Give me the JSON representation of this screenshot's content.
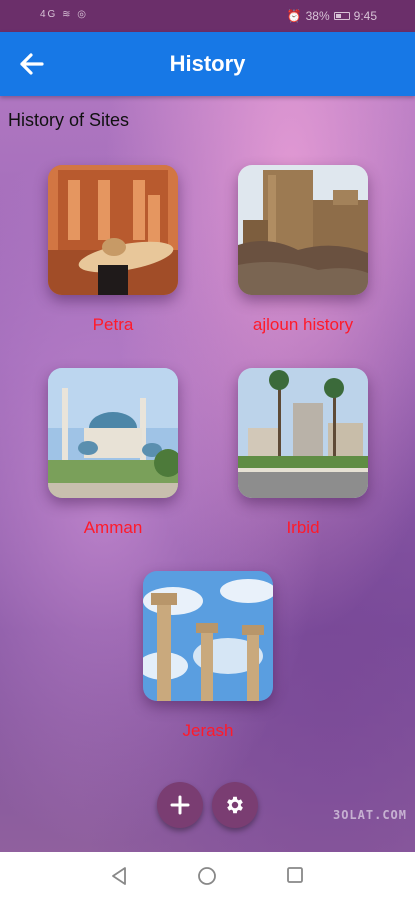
{
  "status_bar": {
    "left_icons": "4G  ≋  ◎",
    "battery": "38%",
    "time": "9:45"
  },
  "app_bar": {
    "title": "History",
    "back_icon": "arrow-left-icon"
  },
  "section_title": "History of Sites",
  "sites": [
    {
      "label": "Petra"
    },
    {
      "label": "ajloun history"
    },
    {
      "label": "Amman"
    },
    {
      "label": "Irbid"
    },
    {
      "label": "Jerash"
    }
  ],
  "fabs": {
    "add_icon": "plus-icon",
    "settings_icon": "gear-icon"
  },
  "watermark": "3OLAT.COM",
  "nav_bar": {
    "back": "back-triangle-icon",
    "home": "home-circle-icon",
    "recents": "recents-square-icon"
  },
  "colors": {
    "app_bar": "#1778e6",
    "status_bar": "#6b2f6a",
    "label": "#ff1a2a",
    "fab": "#7a3d72"
  }
}
